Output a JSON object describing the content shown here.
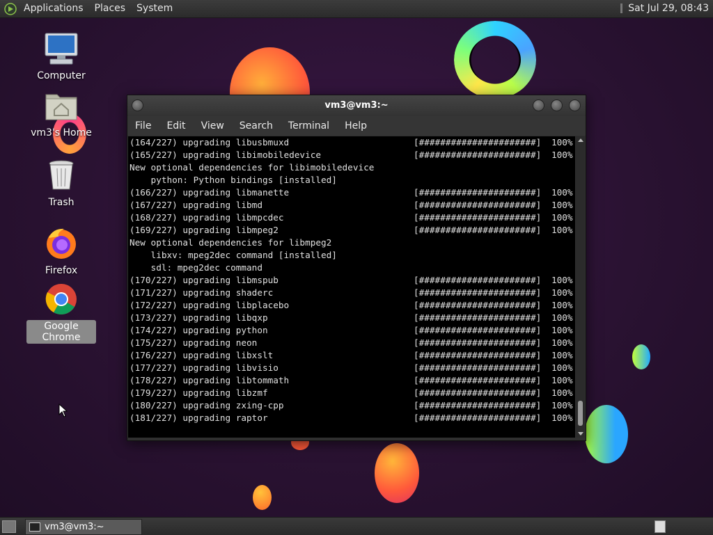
{
  "top_panel": {
    "menus": [
      "Applications",
      "Places",
      "System"
    ],
    "clock": "Sat Jul 29, 08:43"
  },
  "desktop": {
    "icons": [
      {
        "label": "Computer",
        "icon": "computer-icon"
      },
      {
        "label": "vm3's Home",
        "icon": "home-folder-icon"
      },
      {
        "label": "Trash",
        "icon": "trash-icon"
      },
      {
        "label": "Firefox",
        "icon": "firefox-icon"
      },
      {
        "label": "Google Chrome",
        "icon": "chrome-icon",
        "selected": true
      }
    ]
  },
  "terminal": {
    "title": "vm3@vm3:~",
    "menu": [
      "File",
      "Edit",
      "View",
      "Search",
      "Terminal",
      "Help"
    ],
    "lines": [
      {
        "text": "(164/227) upgrading libusbmuxd",
        "bar": "[######################]",
        "pct": "100%"
      },
      {
        "text": "(165/227) upgrading libimobiledevice",
        "bar": "[######################]",
        "pct": "100%"
      },
      {
        "text": "New optional dependencies for libimobiledevice"
      },
      {
        "text": "    python: Python bindings [installed]"
      },
      {
        "text": "(166/227) upgrading libmanette",
        "bar": "[######################]",
        "pct": "100%"
      },
      {
        "text": "(167/227) upgrading libmd",
        "bar": "[######################]",
        "pct": "100%"
      },
      {
        "text": "(168/227) upgrading libmpcdec",
        "bar": "[######################]",
        "pct": "100%"
      },
      {
        "text": "(169/227) upgrading libmpeg2",
        "bar": "[######################]",
        "pct": "100%"
      },
      {
        "text": "New optional dependencies for libmpeg2"
      },
      {
        "text": "    libxv: mpeg2dec command [installed]"
      },
      {
        "text": "    sdl: mpeg2dec command"
      },
      {
        "text": "(170/227) upgrading libmspub",
        "bar": "[######################]",
        "pct": "100%"
      },
      {
        "text": "(171/227) upgrading shaderc",
        "bar": "[######################]",
        "pct": "100%"
      },
      {
        "text": "(172/227) upgrading libplacebo",
        "bar": "[######################]",
        "pct": "100%"
      },
      {
        "text": "(173/227) upgrading libqxp",
        "bar": "[######################]",
        "pct": "100%"
      },
      {
        "text": "(174/227) upgrading python",
        "bar": "[######################]",
        "pct": "100%"
      },
      {
        "text": "(175/227) upgrading neon",
        "bar": "[######################]",
        "pct": "100%"
      },
      {
        "text": "(176/227) upgrading libxslt",
        "bar": "[######################]",
        "pct": "100%"
      },
      {
        "text": "(177/227) upgrading libvisio",
        "bar": "[######################]",
        "pct": "100%"
      },
      {
        "text": "(178/227) upgrading libtommath",
        "bar": "[######################]",
        "pct": "100%"
      },
      {
        "text": "(179/227) upgrading libzmf",
        "bar": "[######################]",
        "pct": "100%"
      },
      {
        "text": "(180/227) upgrading zxing-cpp",
        "bar": "[######################]",
        "pct": "100%"
      },
      {
        "text": "(181/227) upgrading raptor",
        "bar": "[######################]",
        "pct": "100%"
      }
    ]
  },
  "taskbar": {
    "window_button": "vm3@vm3:~"
  }
}
